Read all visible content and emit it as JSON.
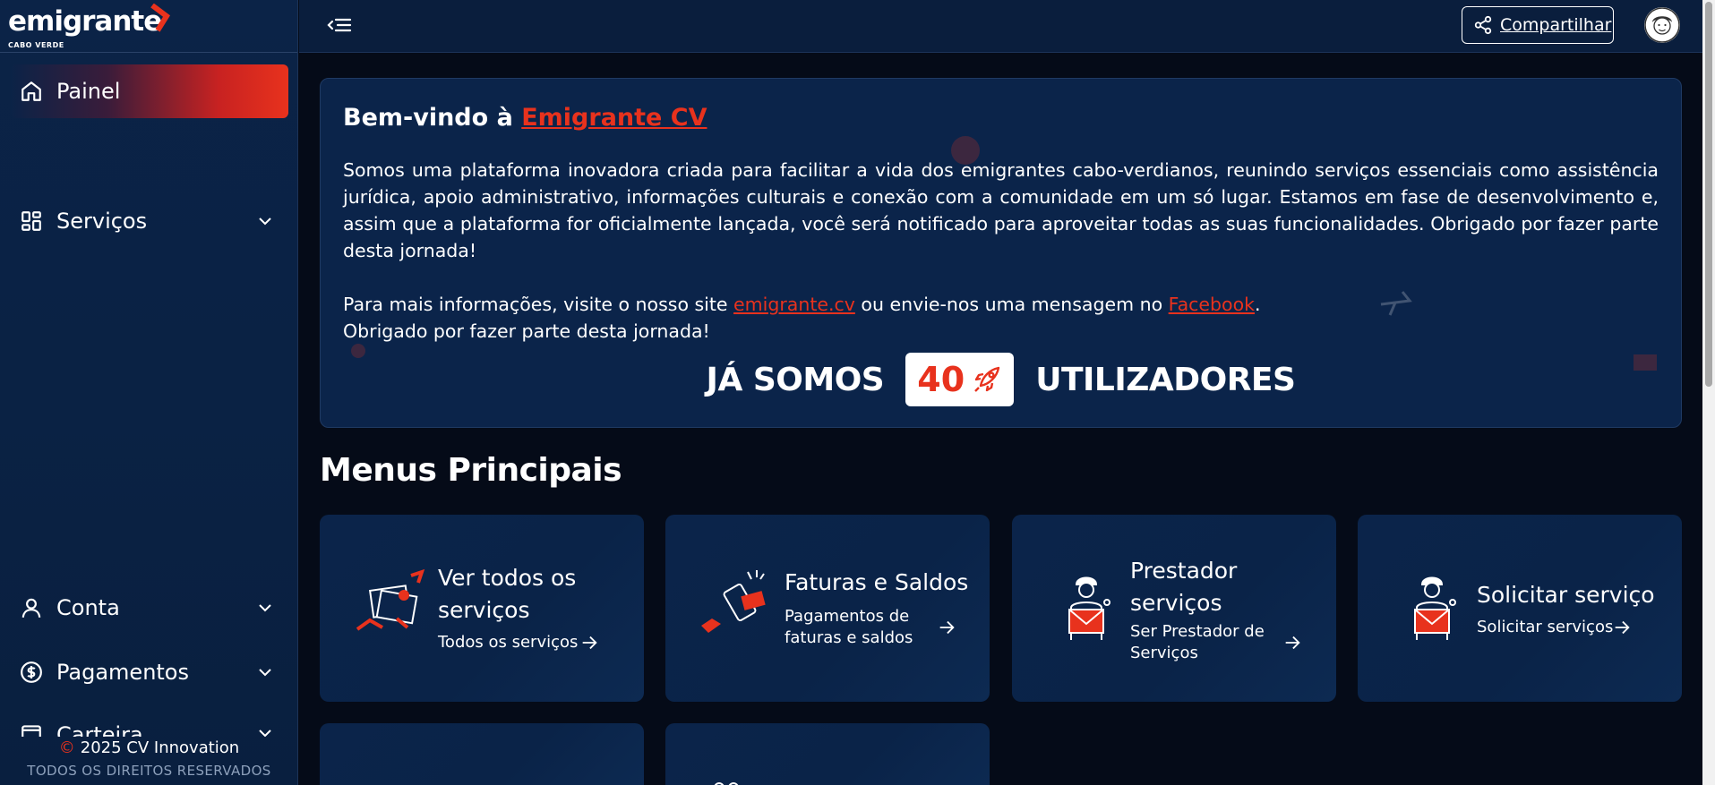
{
  "brand": {
    "logo_text": "emigrante",
    "logo_sub": "CABO VERDE",
    "accent": "#e8321d",
    "navy": "#0b244a"
  },
  "sidebar": {
    "items": [
      {
        "label": "Painel",
        "icon": "home-icon",
        "active": true
      },
      {
        "label": "Serviços",
        "icon": "grid-icon"
      },
      {
        "label": "Conta",
        "icon": "user-icon"
      },
      {
        "label": "Pagamentos",
        "icon": "dollar-icon"
      },
      {
        "label": "Carteira",
        "icon": "wallet-icon"
      }
    ],
    "footer_symbol": "©",
    "footer_copy": "2025 CV Innovation",
    "footer_rights": "TODOS OS DIREITOS RESERVADOS"
  },
  "topbar": {
    "share_label": "Compartilhar"
  },
  "welcome": {
    "title_prefix": "Bem-vindo à ",
    "title_brand": "Emigrante CV",
    "body": "Somos uma plataforma inovadora criada para facilitar a vida dos emigrantes cabo-verdianos, reunindo serviços essenciais como assistência jurídica, apoio administrativo, informações culturais e conexão com a comunidade em um só lugar. Estamos em fase de desenvolvimento e, assim que a plataforma for oficialmente lançada, você será notificado para aproveitar todas as suas funcionalidades. Obrigado por fazer parte desta jornada!",
    "more_prefix": "Para mais informações, visite o nosso site ",
    "site_link": "emigrante.cv",
    "more_mid": " ou envie-nos uma mensagem no ",
    "facebook_link": "Facebook",
    "more_suffix": ".",
    "thanks": "Obrigado por fazer parte desta jornada!",
    "users_pre": "JÁ SOMOS",
    "users_count": "40",
    "users_post": "UTILIZADORES"
  },
  "menus": {
    "title": "Menus Principais",
    "cards": [
      {
        "title_line1": "Ver todos os",
        "title_line2": "serviços",
        "subtitle_line1": "Todos os serviços",
        "subtitle_line2": ""
      },
      {
        "title_line1": "Faturas e Saldos",
        "title_line2": "",
        "subtitle_line1": "Pagamentos de",
        "subtitle_line2": "faturas e saldos"
      },
      {
        "title_line1": "Prestador",
        "title_line2": "serviços",
        "subtitle_line1": "Ser Prestador de",
        "subtitle_line2": "Serviços"
      },
      {
        "title_line1": "Solicitar serviço",
        "title_line2": "",
        "subtitle_line1": "Solicitar serviços",
        "subtitle_line2": ""
      }
    ]
  }
}
